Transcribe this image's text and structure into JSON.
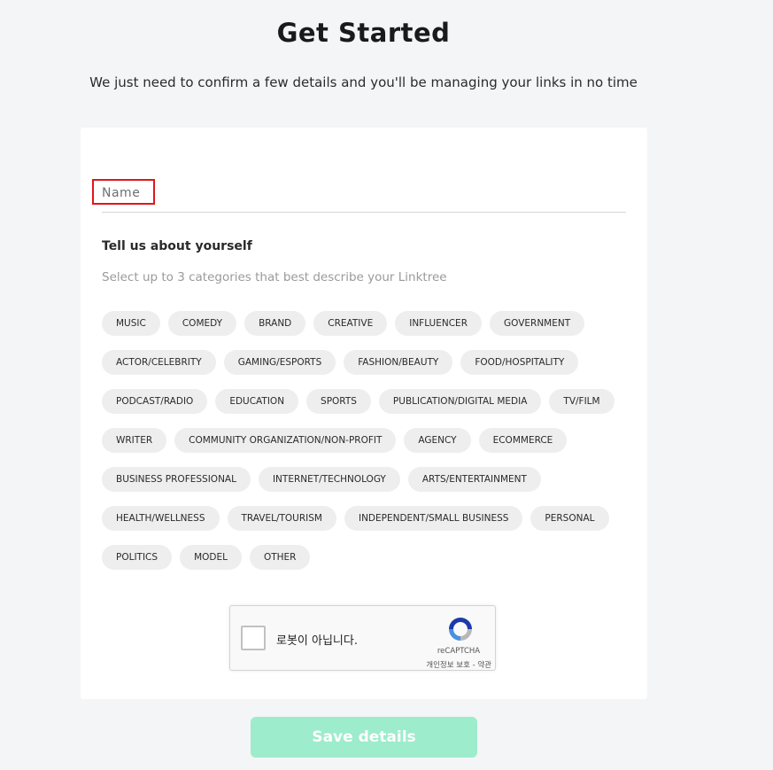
{
  "header": {
    "title": "Get Started",
    "subtitle": "We just need to confirm a few details and you'll be managing your links in no time"
  },
  "form": {
    "name_placeholder": "Name",
    "about_heading": "Tell us about yourself",
    "about_subheading": "Select up to 3 categories that best describe your Linktree",
    "category_rows": [
      [
        "MUSIC",
        "COMEDY",
        "BRAND",
        "CREATIVE",
        "INFLUENCER",
        "GOVERNMENT"
      ],
      [
        "ACTOR/CELEBRITY",
        "GAMING/ESPORTS",
        "FASHION/BEAUTY",
        "FOOD/HOSPITALITY"
      ],
      [
        "PODCAST/RADIO",
        "EDUCATION",
        "SPORTS",
        "PUBLICATION/DIGITAL MEDIA",
        "TV/FILM"
      ],
      [
        "WRITER",
        "COMMUNITY ORGANIZATION/NON-PROFIT",
        "AGENCY",
        "ECOMMERCE"
      ],
      [
        "BUSINESS PROFESSIONAL",
        "INTERNET/TECHNOLOGY",
        "ARTS/ENTERTAINMENT"
      ],
      [
        "HEALTH/WELLNESS",
        "TRAVEL/TOURISM",
        "INDEPENDENT/SMALL BUSINESS",
        "PERSONAL"
      ],
      [
        "POLITICS",
        "MODEL",
        "OTHER"
      ]
    ]
  },
  "recaptcha": {
    "label": "로봇이 아닙니다.",
    "brand": "reCAPTCHA",
    "links": "개인정보 보호 - 약관",
    "icon": "recaptcha-logo-icon"
  },
  "actions": {
    "save_label": "Save details"
  },
  "colors": {
    "background": "#f4f5f7",
    "card": "#ffffff",
    "chip": "#eeeeee",
    "highlight": "#e0161b",
    "save_button": "#9deccc"
  }
}
